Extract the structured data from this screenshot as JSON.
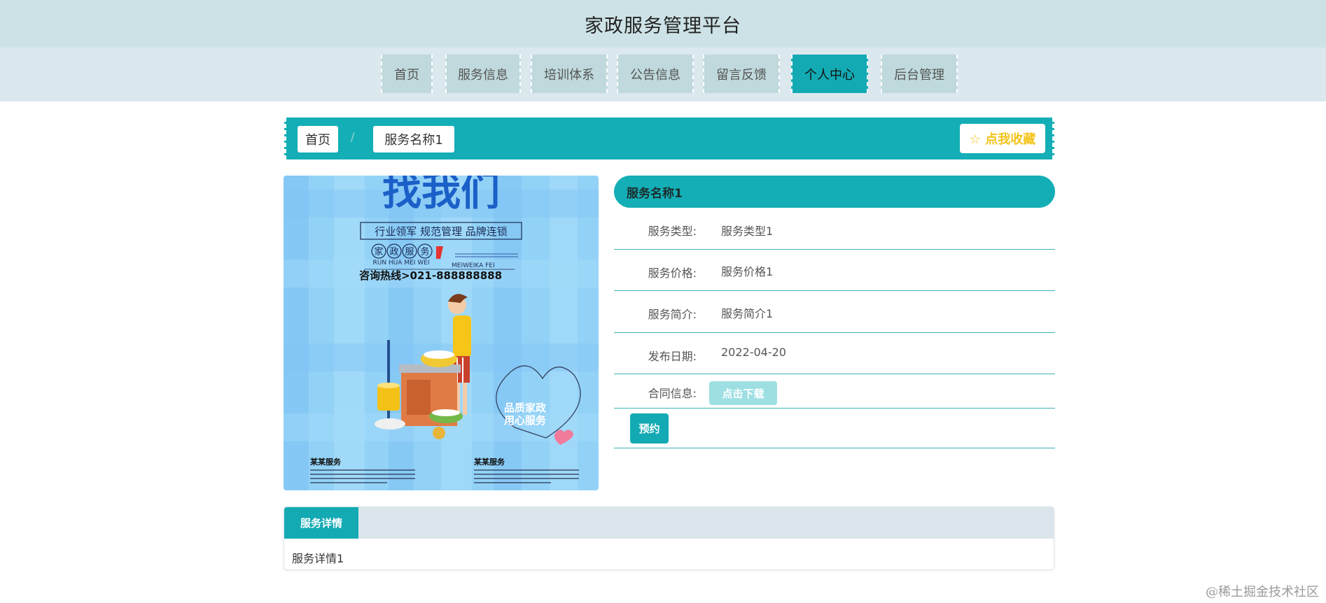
{
  "header": {
    "title": "家政服务管理平台"
  },
  "nav": {
    "items": [
      {
        "label": "首页"
      },
      {
        "label": "服务信息"
      },
      {
        "label": "培训体系"
      },
      {
        "label": "公告信息"
      },
      {
        "label": "留言反馈"
      },
      {
        "label": "个人中心",
        "active": true
      },
      {
        "label": "后台管理"
      }
    ]
  },
  "breadcrumb": {
    "home": "首页",
    "separator": "/",
    "current": "服务名称1",
    "favorite_label": "☆ 点我收藏"
  },
  "poster": {
    "headline": "找我们",
    "tagline": "行业领军  规范管理  品牌连锁",
    "brand_chars": [
      "家",
      "政",
      "服",
      "务"
    ],
    "pinyin": "RUN HUA MEI WEI",
    "pinyin_right": "MEIWEIKA FEI",
    "hotline": "咨询热线>021-888888888",
    "bubble_line1": "品质家政",
    "bubble_line2": "用心服务",
    "footer_left": "某某服务",
    "footer_right": "某某服务"
  },
  "service": {
    "name": "服务名称1",
    "fields": [
      {
        "label": "服务类型:",
        "value": "服务类型1"
      },
      {
        "label": "服务价格:",
        "value": "服务价格1"
      },
      {
        "label": "服务简介:",
        "value": "服务简介1"
      },
      {
        "label": "发布日期:",
        "value": "2022-04-20"
      }
    ],
    "contract_label": "合同信息:",
    "download_label": "点击下载",
    "book_label": "预约"
  },
  "detail": {
    "tab_label": "服务详情",
    "content": "服务详情1"
  },
  "watermark": "@稀土掘金技术社区",
  "colors": {
    "accent": "#14aeb6",
    "header_bg": "#cde2e6",
    "nav_bg": "#dbe8ee",
    "nav_item_bg": "#bfd9dc",
    "favorite_text": "#f3c318"
  }
}
